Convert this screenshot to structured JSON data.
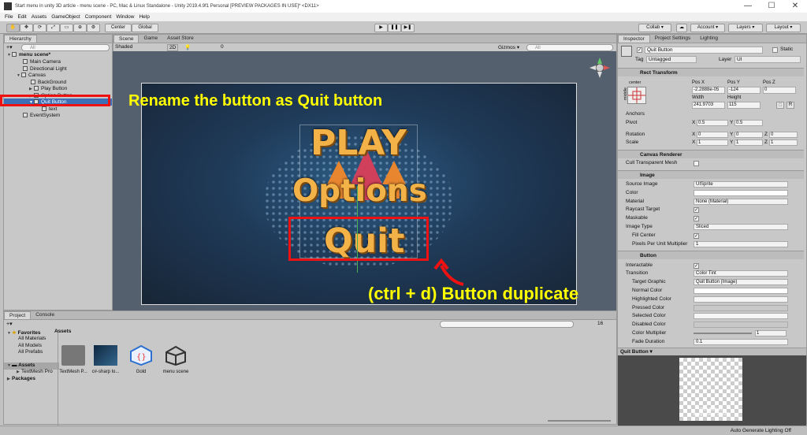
{
  "window": {
    "title": "Start menu in unity 3D article - menu scene - PC, Mac & Linux Standalone - Unity 2019.4.9f1 Personal [PREVIEW PACKAGES IN USE]* <DX11>",
    "minimize": "—",
    "maximize": "☐",
    "close": "✕"
  },
  "menubar": [
    "File",
    "Edit",
    "Assets",
    "GameObject",
    "Component",
    "Window",
    "Help"
  ],
  "toolbar": {
    "center": "Center",
    "global": "Global",
    "collab": "Collab ▾",
    "account": "Account ▾",
    "layers": "Layers ▾",
    "layout": "Layout ▾"
  },
  "hierarchy": {
    "tab": "Hierarchy",
    "search_placeholder": "All",
    "create": "+▾",
    "items": [
      {
        "label": "menu scene*"
      },
      {
        "label": "Main Camera"
      },
      {
        "label": "Directional Light"
      },
      {
        "label": "Canvas"
      },
      {
        "label": "BackGround"
      },
      {
        "label": "Play Button"
      },
      {
        "label": "Option Button"
      },
      {
        "label": "Quit Button"
      },
      {
        "label": "text"
      },
      {
        "label": "EventSystem"
      }
    ]
  },
  "scene": {
    "tabs": [
      "Scene",
      "Game",
      "Asset Store"
    ],
    "shading": "Shaded",
    "mode_2d": "2D",
    "gizmos": "Gizmos ▾",
    "search_placeholder": "All",
    "layer_count": "0",
    "canvas_text": {
      "play": "PLAY",
      "options": "Options",
      "quit": "Quit"
    },
    "annotations": {
      "rename": "Rename the button as Quit button",
      "duplicate": "(ctrl + d) Button duplicate"
    },
    "colors": {
      "annotation": "#ffff00",
      "highlight": "#e11111",
      "button_text": "#f3b247"
    }
  },
  "inspector": {
    "tabs": [
      "Inspector",
      "Project Settings",
      "Lighting"
    ],
    "object_name": "Quit Button",
    "static": "Static",
    "tag_label": "Tag",
    "tag": "Untagged",
    "layer_label": "Layer",
    "layer": "UI",
    "rect_transform": {
      "header": "Rect Transform",
      "anchor_preset": "center",
      "side_label": "middle",
      "pos_x_label": "Pos X",
      "pos_x": "-2.2888e-05",
      "pos_y_label": "Pos Y",
      "pos_y": "-124",
      "pos_z_label": "Pos Z",
      "pos_z": "0",
      "width_label": "Width",
      "width": "241.9703",
      "height_label": "Height",
      "height": "115",
      "raw_btn": "R",
      "anchors": "Anchors",
      "pivot": "Pivot",
      "pivot_x": "0.5",
      "pivot_y": "0.5",
      "rotation": "Rotation",
      "rot_x": "0",
      "rot_y": "0",
      "rot_z": "0",
      "scale": "Scale",
      "scale_x": "1",
      "scale_y": "1",
      "scale_z": "1",
      "x": "X",
      "y": "Y",
      "z": "Z"
    },
    "canvas_renderer": {
      "header": "Canvas Renderer",
      "cull": "Cull Transparent Mesh"
    },
    "image": {
      "header": "Image",
      "source_image_label": "Source Image",
      "source_image": "UISprite",
      "color_label": "Color",
      "material_label": "Material",
      "material": "None (Material)",
      "raycast_label": "Raycast Target",
      "maskable_label": "Maskable",
      "image_type_label": "Image Type",
      "image_type": "Sliced",
      "fill_center_label": "Fill Center",
      "ppu_label": "Pixels Per Unit Multiplier",
      "ppu": "1"
    },
    "button": {
      "header": "Button",
      "interactable_label": "Interactable",
      "transition_label": "Transition",
      "transition": "Color Tint",
      "target_graphic_label": "Target Graphic",
      "target_graphic": "Quit Button (Image)",
      "normal_color": "Normal Color",
      "highlighted_color": "Highlighted Color",
      "pressed_color": "Pressed Color",
      "selected_color": "Selected Color",
      "disabled_color": "Disabled Color",
      "color_multiplier_label": "Color Multiplier",
      "color_multiplier": "1",
      "fade_duration_label": "Fade Duration",
      "fade_duration": "0.1"
    },
    "preview": {
      "header": "Quit Button ▾",
      "caption1": "Quit Button",
      "caption2": "Image Size: 32x32"
    }
  },
  "project": {
    "tabs": [
      "Project",
      "Console"
    ],
    "create": "+▾",
    "hidden_count": "16",
    "favorites": "Favorites",
    "fav_items": [
      "All Materials",
      "All Models",
      "All Prefabs"
    ],
    "assets": "Assets",
    "asset_children": [
      "TextMesh Pro"
    ],
    "packages": "Packages",
    "breadcrumb": "Assets",
    "items": [
      {
        "label": "TextMesh P...",
        "icon": "folder-icon"
      },
      {
        "label": "c#-sharp lo...",
        "icon": "image-icon"
      },
      {
        "label": "Gold",
        "icon": "material-icon"
      },
      {
        "label": "menu scene",
        "icon": "unity-scene-icon"
      }
    ]
  },
  "status": {
    "text": "Auto Generate Lighting Off"
  }
}
